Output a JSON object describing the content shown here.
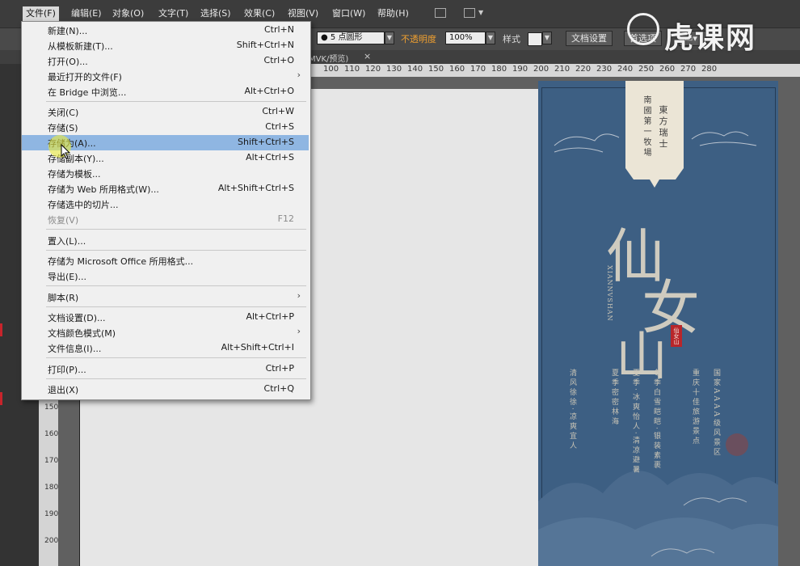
{
  "menubar": {
    "items": [
      "文件(F)",
      "编辑(E)",
      "对象(O)",
      "文字(T)",
      "选择(S)",
      "效果(C)",
      "视图(V)",
      "窗口(W)",
      "帮助(H)"
    ]
  },
  "control_bar": {
    "brush_value": "5 点圆形",
    "opacity_label": "不透明度",
    "opacity_value": "100%",
    "style_label": "样式",
    "doc_setup_button": "文档设置",
    "prefs_button": "首选项"
  },
  "document_tab": {
    "title": "MVK/预览)",
    "close": "×"
  },
  "ruler": {
    "h_labels": [
      "100",
      "110",
      "120",
      "130",
      "140",
      "150",
      "160",
      "170",
      "180",
      "190",
      "200",
      "210",
      "220",
      "230",
      "240",
      "250",
      "260",
      "270",
      "280"
    ],
    "v_labels": [
      "150",
      "160",
      "170",
      "180",
      "190",
      "200",
      "210"
    ]
  },
  "file_menu": {
    "groups": [
      [
        {
          "label": "新建(N)...",
          "shortcut": "Ctrl+N"
        },
        {
          "label": "从模板新建(T)...",
          "shortcut": "Shift+Ctrl+N"
        },
        {
          "label": "打开(O)...",
          "shortcut": "Ctrl+O"
        },
        {
          "label": "最近打开的文件(F)",
          "shortcut": "",
          "submenu": true
        },
        {
          "label": "在 Bridge 中浏览...",
          "shortcut": "Alt+Ctrl+O"
        }
      ],
      [
        {
          "label": "关闭(C)",
          "shortcut": "Ctrl+W"
        },
        {
          "label": "存储(S)",
          "shortcut": "Ctrl+S"
        },
        {
          "label": "存储为(A)...",
          "shortcut": "Shift+Ctrl+S",
          "highlighted": true
        },
        {
          "label": "存储副本(Y)...",
          "shortcut": "Alt+Ctrl+S"
        },
        {
          "label": "存储为模板...",
          "shortcut": ""
        },
        {
          "label": "存储为 Web 所用格式(W)...",
          "shortcut": "Alt+Shift+Ctrl+S"
        },
        {
          "label": "存储选中的切片...",
          "shortcut": ""
        },
        {
          "label": "恢复(V)",
          "shortcut": "F12",
          "disabled": true
        }
      ],
      [
        {
          "label": "置入(L)...",
          "shortcut": ""
        }
      ],
      [
        {
          "label": "存储为 Microsoft Office 所用格式...",
          "shortcut": ""
        },
        {
          "label": "导出(E)...",
          "shortcut": ""
        }
      ],
      [
        {
          "label": "脚本(R)",
          "shortcut": "",
          "submenu": true
        }
      ],
      [
        {
          "label": "文档设置(D)...",
          "shortcut": "Alt+Ctrl+P"
        },
        {
          "label": "文档颜色模式(M)",
          "shortcut": "",
          "submenu": true
        },
        {
          "label": "文件信息(I)...",
          "shortcut": "Alt+Shift+Ctrl+I"
        }
      ],
      [
        {
          "label": "打印(P)...",
          "shortcut": "Ctrl+P"
        }
      ],
      [
        {
          "label": "退出(X)",
          "shortcut": "Ctrl+Q"
        }
      ]
    ],
    "submenu_arrow": "›"
  },
  "poster": {
    "label_left": "南國第一牧場",
    "label_right": "東方瑞士",
    "big_1": "仙",
    "big_2": "女",
    "big_3": "山",
    "pinyin": "XIANNVSHAN",
    "seal": "仙女山",
    "columns": [
      "国家AAAA级风景区",
      "重庆十佳旅游景点",
      "冬季白雪皑皑·银装素裹",
      "夏季·冰爽怡人·清凉避暑",
      "夏季密密林海",
      "清风徐徐·凉爽宜人"
    ]
  },
  "watermark": {
    "text": "虎课网"
  }
}
